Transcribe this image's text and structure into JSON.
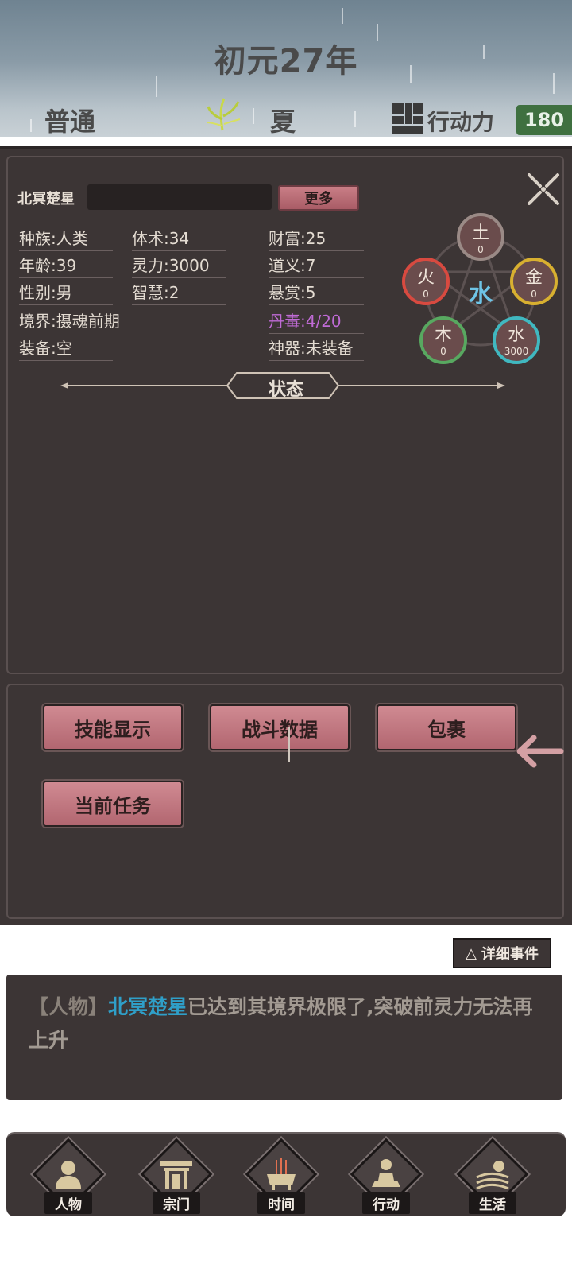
{
  "header": {
    "year": "初元27年",
    "difficulty": "普通",
    "season": "夏",
    "action_label": "行动力",
    "action_value": "180"
  },
  "character": {
    "name_label": "北冥楚星",
    "more_button": "更多",
    "stats": {
      "race": "种族:人类",
      "age": "年龄:39",
      "gender": "性别:男",
      "realm": "境界:摄魂前期",
      "equipment": "装备:空",
      "body": "体术:34",
      "spirit": "灵力:3000",
      "wisdom": "智慧:2",
      "wealth": "财富:25",
      "morality": "道义:7",
      "bounty": "悬赏:5",
      "poison": "丹毒:4/20",
      "artifact": "神器:未装备"
    },
    "elements": {
      "center": "水",
      "earth": {
        "label": "土",
        "value": "0"
      },
      "metal": {
        "label": "金",
        "value": "0"
      },
      "water": {
        "label": "水",
        "value": "3000"
      },
      "wood": {
        "label": "木",
        "value": "0"
      },
      "fire": {
        "label": "火",
        "value": "0"
      }
    },
    "status_title": "状态"
  },
  "actions": {
    "skills": "技能显示",
    "battle": "战斗数据",
    "bag": "包裹",
    "tasks": "当前任务"
  },
  "events": {
    "detail_button": "详细事件",
    "detail_symbol": "△",
    "tag": "【人物】",
    "name": "北冥楚星",
    "message": "已达到其境界极限了,突破前灵力无法再上升"
  },
  "nav": {
    "character": "人物",
    "sect": "宗门",
    "time": "时间",
    "action": "行动",
    "life": "生活"
  },
  "colors": {
    "panel": "#3c3535",
    "button_pink": "#c07880",
    "action_green": "#3f7040",
    "poison": "#c06bd6",
    "name_highlight": "#2f9fc8"
  }
}
